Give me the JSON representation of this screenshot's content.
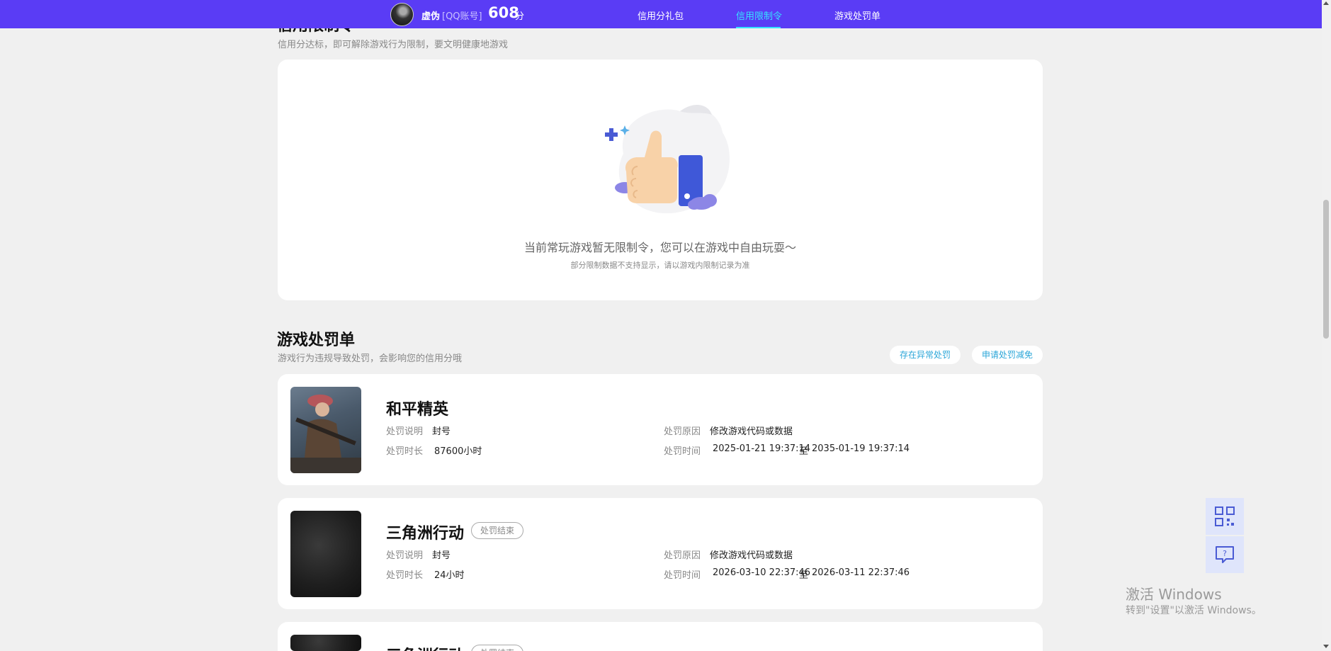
{
  "header": {
    "user_name": "虚伪",
    "account_type": "[QQ账号]",
    "score": "608",
    "score_unit": "分",
    "nav": [
      {
        "label": "信用分礼包",
        "active": false
      },
      {
        "label": "信用限制令",
        "active": true
      },
      {
        "label": "游戏处罚单",
        "active": false
      }
    ]
  },
  "restriction": {
    "title_clipped": "信用限制令",
    "subtitle": "信用分达标，即可解除游戏行为限制，要文明健康地游戏",
    "empty_message": "当前常玩游戏暂无限制令，您可以在游戏中自由玩耍～",
    "empty_note": "部分限制数据不支持显示，请以游戏内限制记录为准"
  },
  "penalties": {
    "title": "游戏处罚单",
    "subtitle": "游戏行为违规导致处罚，会影响您的信用分哦",
    "actions": [
      "存在异常处罚",
      "申请处罚减免"
    ],
    "labels": {
      "desc": "处罚说明",
      "duration": "处罚时长",
      "reason": "处罚原因",
      "time": "处罚时间",
      "to": "至"
    },
    "items": [
      {
        "game": "和平精英",
        "badge": "",
        "desc": "封号",
        "duration": "87600小时",
        "reason": "修改游戏代码或数据",
        "time_start": "2025-01-21 19:37:14",
        "time_end": "2035-01-19 19:37:14"
      },
      {
        "game": "三角洲行动",
        "badge": "处罚结束",
        "desc": "封号",
        "duration": "24小时",
        "reason": "修改游戏代码或数据",
        "time_start": "2026-03-10 22:37:46",
        "time_end": "2026-03-11 22:37:46"
      },
      {
        "game": "三角洲行动",
        "badge": "处罚结束"
      }
    ]
  },
  "watermark": {
    "title": "激活 Windows",
    "subtitle": "转到\"设置\"以激活 Windows。"
  },
  "colors": {
    "header_bg": "#5a3cf5",
    "nav_active": "#36e2ff",
    "pill_text": "#2ba6d8"
  }
}
